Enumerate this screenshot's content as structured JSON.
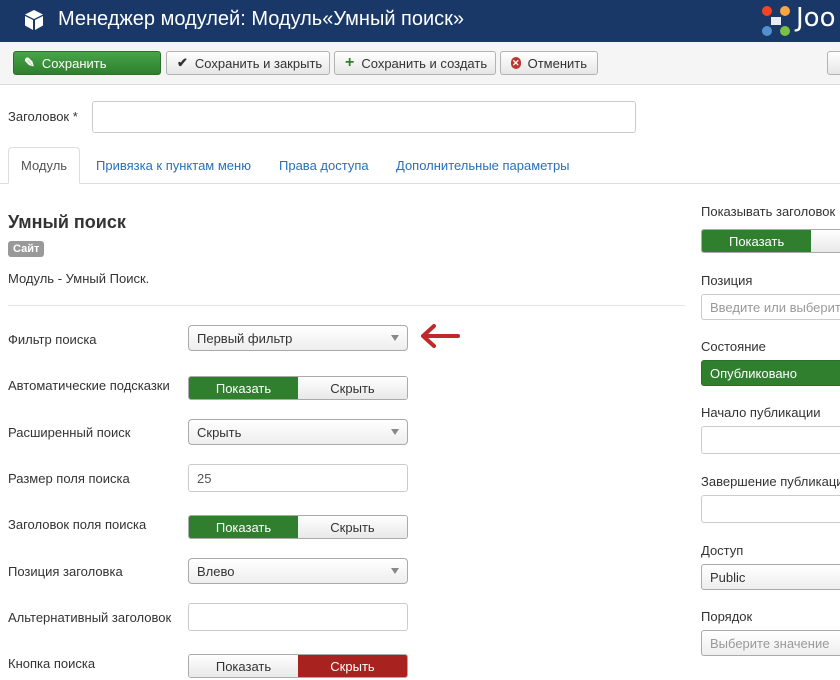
{
  "header": {
    "title": "Менеджер модулей: Модуль«Умный поиск»",
    "logo_text": "Joo"
  },
  "toolbar": {
    "save_label": "Сохранить",
    "save_close_label": "Сохранить и закрыть",
    "save_new_label": "Сохранить и создать",
    "cancel_label": "Отменить"
  },
  "title_field": {
    "label": "Заголовок *",
    "value": ""
  },
  "tabs": [
    {
      "label": "Модуль"
    },
    {
      "label": "Привязка к пунктам меню"
    },
    {
      "label": "Права доступа"
    },
    {
      "label": "Дополнительные параметры"
    }
  ],
  "module": {
    "heading": "Умный поиск",
    "badge": "Сайт",
    "description": "Модуль - Умный Поиск."
  },
  "fields": {
    "search_filter": {
      "label": "Фильтр поиска",
      "value": "Первый фильтр"
    },
    "auto_suggest": {
      "label": "Автоматические подсказки",
      "show": "Показать",
      "hide": "Скрыть"
    },
    "advanced_search": {
      "label": "Расширенный поиск",
      "value": "Скрыть"
    },
    "field_size": {
      "label": "Размер поля поиска",
      "value": "25"
    },
    "field_label": {
      "label": "Заголовок поля поиска",
      "show": "Показать",
      "hide": "Скрыть"
    },
    "label_position": {
      "label": "Позиция заголовка",
      "value": "Влево"
    },
    "alt_label": {
      "label": "Альтернативный заголовок",
      "value": ""
    },
    "search_button": {
      "label": "Кнопка поиска",
      "show": "Показать",
      "hide": "Скрыть"
    }
  },
  "sidebar": {
    "show_title": {
      "label": "Показывать заголовок",
      "show": "Показать"
    },
    "position": {
      "label": "Позиция",
      "placeholder": "Введите или выберите"
    },
    "status": {
      "label": "Состояние",
      "value": "Опубликовано"
    },
    "publish_up": {
      "label": "Начало публикации",
      "value": ""
    },
    "publish_down": {
      "label": "Завершение публикации",
      "value": ""
    },
    "access": {
      "label": "Доступ",
      "value": "Public"
    },
    "ordering": {
      "label": "Порядок",
      "placeholder": "Выберите значение"
    }
  },
  "colors": {
    "header_bg": "#1a3867",
    "success": "#2f7f2f",
    "danger": "#a8231f",
    "link": "#2a6fb8",
    "arrow": "#c0282a"
  }
}
